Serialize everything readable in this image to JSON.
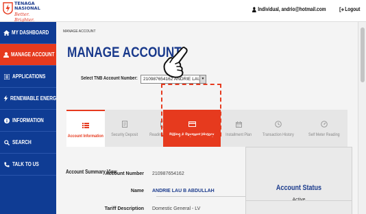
{
  "brand": {
    "name_line1": "TENAGA",
    "name_line2": "NASIONAL",
    "tagline": "Better. Brighter.",
    "accent_color": "#e63a1e",
    "brand_color": "#0f3c94"
  },
  "header": {
    "user_icon": "user-icon",
    "user_text": "Individual, andrio@hotmail.com",
    "logout_icon": "logout-icon",
    "logout_label": "Logout"
  },
  "sidebar": {
    "items": [
      {
        "icon": "home-icon",
        "label": "MY DASHBOARD",
        "active": false
      },
      {
        "icon": "user-icon",
        "label": "MANAGE ACCOUNT",
        "active": true
      },
      {
        "icon": "list-icon",
        "label": "APPLICATIONS",
        "active": false
      },
      {
        "icon": "bolt-icon",
        "label": "RENEWABLE ENERGY",
        "active": false
      },
      {
        "icon": "info-icon",
        "label": "INFORMATION",
        "active": false
      },
      {
        "icon": "search-icon",
        "label": "SEARCH",
        "active": false
      },
      {
        "icon": "phone-icon",
        "label": "TALK TO US",
        "active": false
      }
    ]
  },
  "main": {
    "breadcrumb": "MANAGE ACCOUNT",
    "title": "MANAGE ACCOUNT",
    "account_select": {
      "label": "Select TNB Account Number:",
      "value": "210987654162 ANDRIE LAU"
    },
    "tabs": [
      {
        "icon": "list-icon",
        "label": "Account Information",
        "state": "selected"
      },
      {
        "icon": "document-icon",
        "label": "Security Deposit",
        "state": "normal"
      },
      {
        "icon": "phone-device-icon",
        "label": "Reading History",
        "state": "normal"
      },
      {
        "icon": "credit-card-icon",
        "label": "Billing & Payment History",
        "state": "highlighted"
      },
      {
        "icon": "calendar-icon",
        "label": "Installment Plan",
        "state": "normal"
      },
      {
        "icon": "clock-icon",
        "label": "Transaction History",
        "state": "normal"
      },
      {
        "icon": "meter-icon",
        "label": "Self Meter Reading",
        "state": "normal"
      }
    ],
    "summary": {
      "title": "Account Summary View",
      "rows": [
        {
          "label": "Account Number",
          "value": "210987654162",
          "value_color": "#444444"
        },
        {
          "label": "Name",
          "value": "ANDRIE LAU B ABDULLAH",
          "value_color": "#1a3a8c"
        },
        {
          "label": "Tariff Description",
          "value": "Domestic General - LV",
          "value_color": "#444444"
        }
      ]
    },
    "status": {
      "title": "Account Status",
      "value": "Active"
    }
  }
}
